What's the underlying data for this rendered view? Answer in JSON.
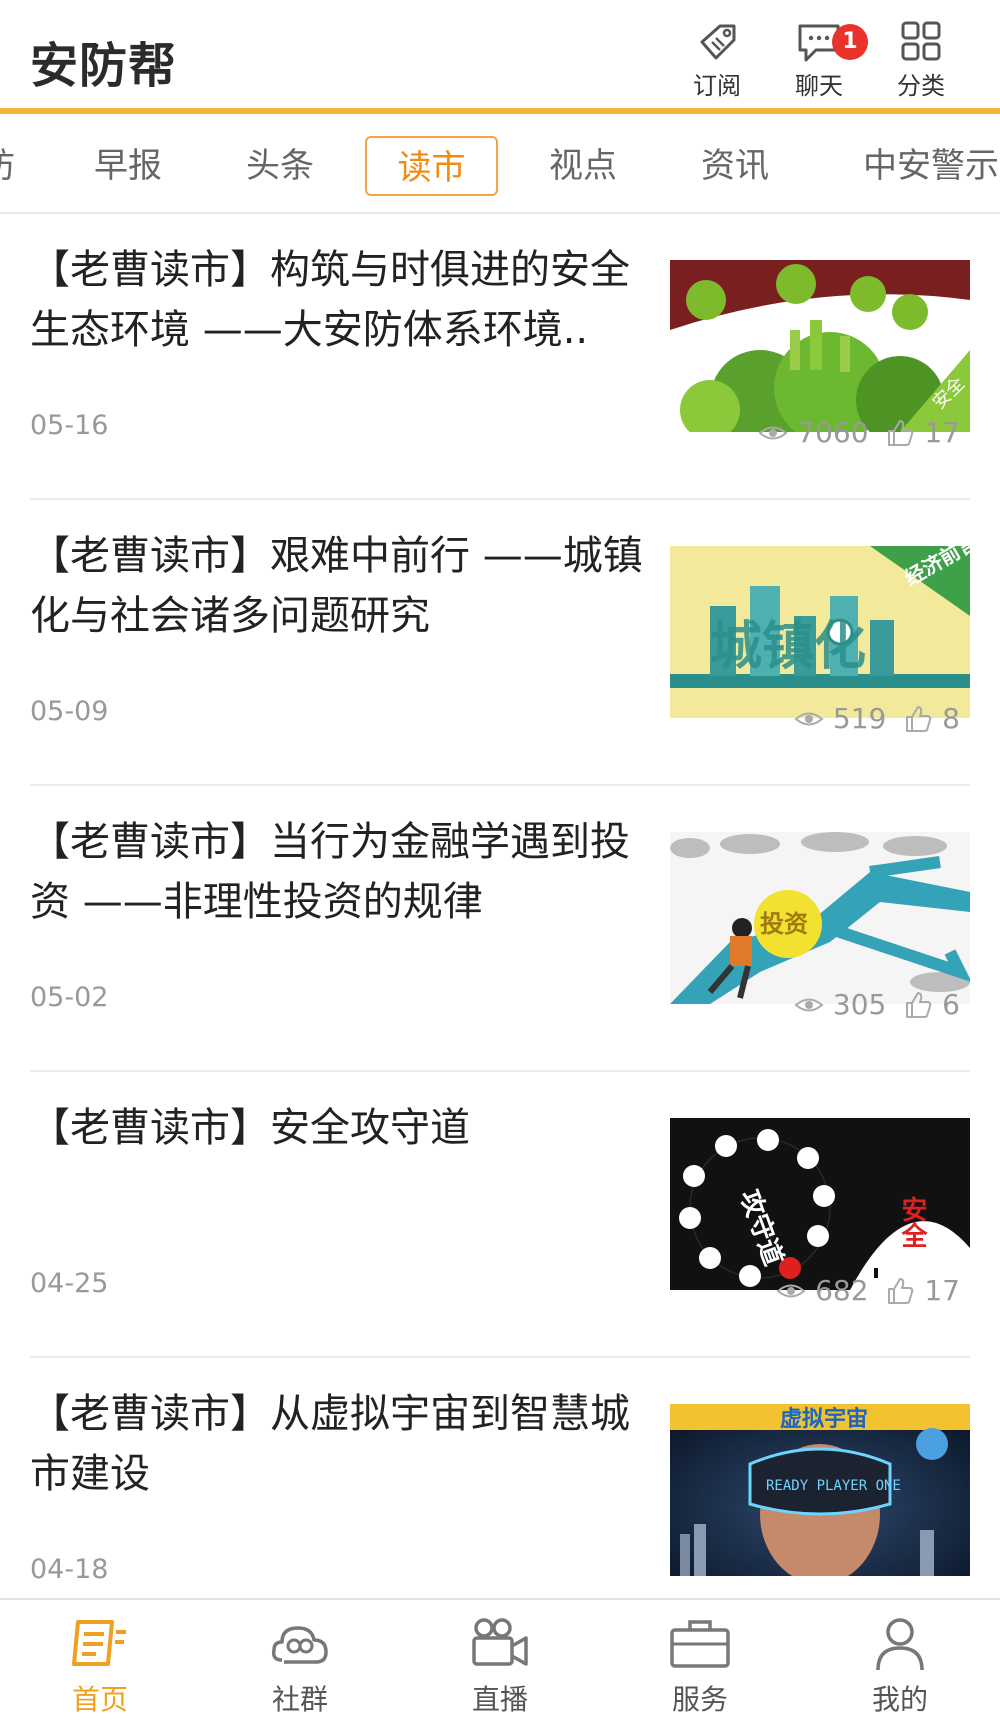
{
  "header": {
    "logo": "安防帮",
    "subscribe_label": "订阅",
    "chat_label": "聊天",
    "chat_badge": "1",
    "category_label": "分类"
  },
  "tabs": [
    {
      "label": "防",
      "active": false
    },
    {
      "label": "早报",
      "active": false
    },
    {
      "label": "头条",
      "active": false
    },
    {
      "label": "读市",
      "active": true
    },
    {
      "label": "视点",
      "active": false
    },
    {
      "label": "资讯",
      "active": false
    },
    {
      "label": "中安警示",
      "active": false
    }
  ],
  "articles": [
    {
      "title": "【老曹读市】构筑与时俱进的安全生态环境 ——大安防体系环境..",
      "date": "05-16",
      "views": "7060",
      "likes": "17"
    },
    {
      "title": "【老曹读市】艰难中前行 ——城镇化与社会诸多问题研究",
      "date": "05-09",
      "views": "519",
      "likes": "8"
    },
    {
      "title": "【老曹读市】当行为金融学遇到投资 ——非理性投资的规律",
      "date": "05-02",
      "views": "305",
      "likes": "6"
    },
    {
      "title": "【老曹读市】安全攻守道",
      "date": "04-25",
      "views": "682",
      "likes": "17"
    },
    {
      "title": "【老曹读市】从虚拟宇宙到智慧城市建设",
      "date": "04-18",
      "views": "",
      "likes": ""
    }
  ],
  "thumb_text": {
    "t1": "安全",
    "t2a": "经济前言",
    "t2b": "城镇化",
    "t3": "投资",
    "t4a": "攻守道",
    "t4b": "安全",
    "t5a": "虚拟宇宙",
    "t5b": "READY PLAYER ONE"
  },
  "bottom_nav": [
    {
      "label": "首页",
      "active": true
    },
    {
      "label": "社群",
      "active": false
    },
    {
      "label": "直播",
      "active": false
    },
    {
      "label": "服务",
      "active": false
    },
    {
      "label": "我的",
      "active": false
    }
  ],
  "colors": {
    "accent": "#f4b43a",
    "active_tab": "#f08c14",
    "badge": "#e8322c"
  }
}
